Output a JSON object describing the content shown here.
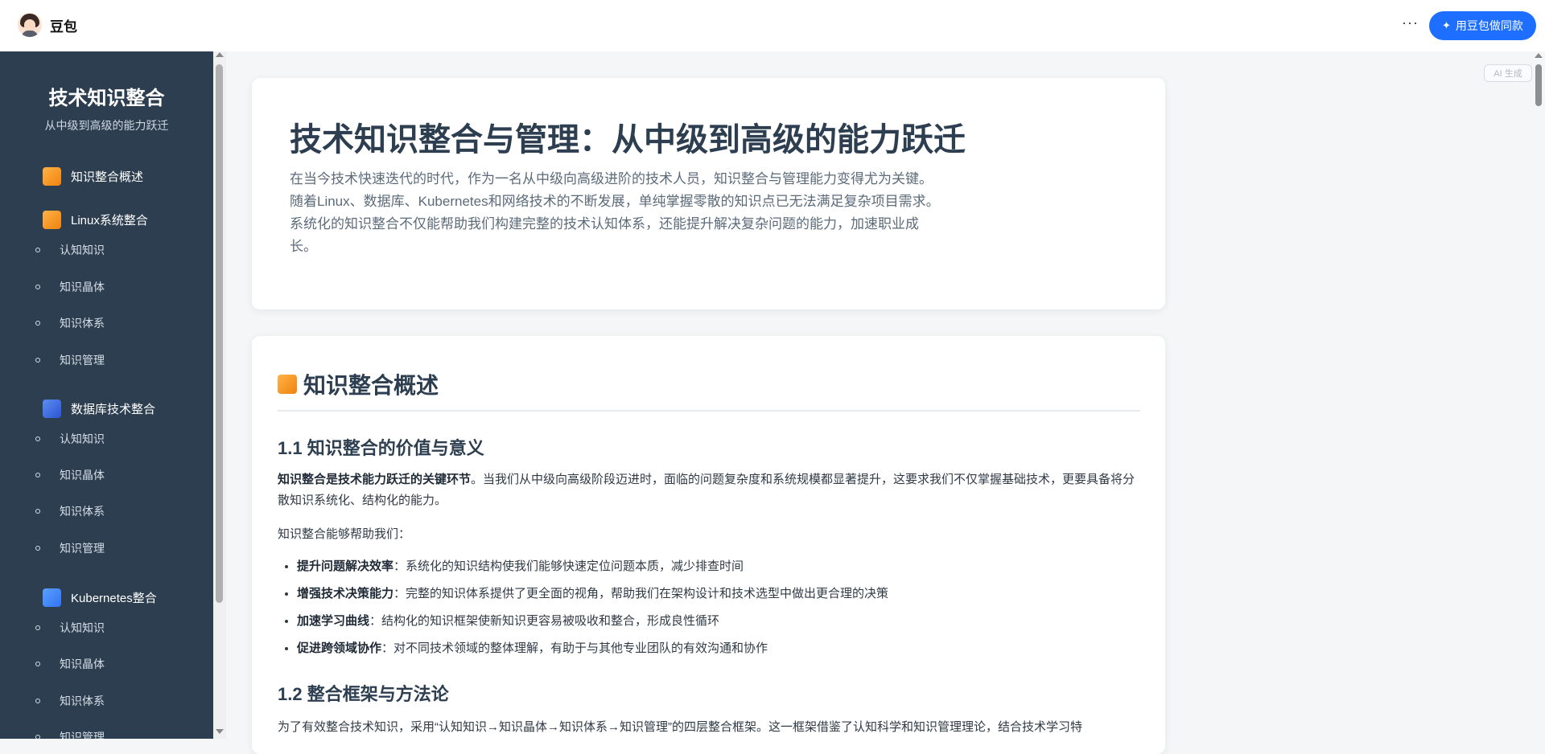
{
  "app": {
    "name": "豆包"
  },
  "topbar": {
    "more": "···",
    "cta_label": "用豆包做同款",
    "ai_badge": "AI 生成"
  },
  "sidebar": {
    "title": "技术知识整合",
    "subtitle": "从中级到高级的能力跃迁",
    "sections": [
      {
        "label": "知识整合概述",
        "color": "#f39c12",
        "children": []
      },
      {
        "label": "Linux系统整合",
        "color": "#f39c12",
        "children": [
          "认知知识",
          "知识晶体",
          "知识体系",
          "知识管理"
        ]
      },
      {
        "label": "数据库技术整合",
        "color": "#3b5fe0",
        "children": [
          "认知知识",
          "知识晶体",
          "知识体系",
          "知识管理"
        ]
      },
      {
        "label": "Kubernetes整合",
        "color": "#3d7cf5",
        "children": [
          "认知知识",
          "知识晶体",
          "知识体系",
          "知识管理"
        ]
      }
    ]
  },
  "hero": {
    "title": "技术知识整合与管理：从中级到高级的能力跃迁",
    "desc": "在当今技术快速迭代的时代，作为一名从中级向高级进阶的技术人员，知识整合与管理能力变得尤为关键。随着Linux、数据库、Kubernetes和网络技术的不断发展，单纯掌握零散的知识点已无法满足复杂项目需求。系统化的知识整合不仅能帮助我们构建完整的技术认知体系，还能提升解决复杂问题的能力，加速职业成长。"
  },
  "content": {
    "section_title": "知识整合概述",
    "h1_1": "1.1 知识整合的价值与意义",
    "p1_bold": "知识整合是技术能力跃迁的关键环节",
    "p1_rest": "。当我们从中级向高级阶段迈进时，面临的问题复杂度和系统规模都显著提升，这要求我们不仅掌握基础技术，更要具备将分散知识系统化、结构化的能力。",
    "p2": "知识整合能够帮助我们：",
    "list": [
      {
        "bold": "提升问题解决效率",
        "text": "：系统化的知识结构使我们能够快速定位问题本质，减少排查时间"
      },
      {
        "bold": "增强技术决策能力",
        "text": "：完整的知识体系提供了更全面的视角，帮助我们在架构设计和技术选型中做出更合理的决策"
      },
      {
        "bold": "加速学习曲线",
        "text": "：结构化的知识框架使新知识更容易被吸收和整合，形成良性循环"
      },
      {
        "bold": "促进跨领域协作",
        "text": "：对不同技术领域的整体理解，有助于与其他专业团队的有效沟通和协作"
      }
    ],
    "h1_2": "1.2 整合框架与方法论",
    "p3": "为了有效整合技术知识，采用“认知知识→知识晶体→知识体系→知识管理”的四层整合框架。这一框架借鉴了认知科学和知识管理理论，结合技术学习特"
  }
}
